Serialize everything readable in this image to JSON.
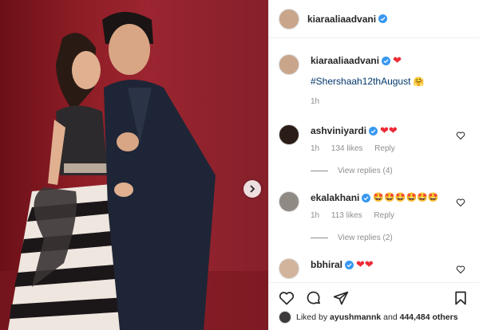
{
  "post": {
    "author": "kiaraaliaadvani",
    "verified": true
  },
  "caption": {
    "author": "kiaraaliaadvani",
    "emoji": "❤",
    "hashtag": "#Shershaah12thAugust",
    "hashtag_emoji": "🤗",
    "time": "1h"
  },
  "comments": [
    {
      "author": "ashviniyardi",
      "text": "❤❤",
      "time": "1h",
      "likes": "134 likes",
      "reply_label": "Reply",
      "view_replies": "View replies (4)"
    },
    {
      "author": "ekalakhani",
      "text": "🤩🤩🤩🤩🤩🤩",
      "time": "1h",
      "likes": "113 likes",
      "reply_label": "Reply",
      "view_replies": "View replies (2)"
    },
    {
      "author": "bbhiral",
      "text": "❤❤"
    }
  ],
  "likes_summary": {
    "prefix": "Liked by",
    "user": "ayushmannk",
    "joiner": "and",
    "count": "444,484 others"
  },
  "colors": {
    "verified": "#3897f0",
    "heart": "#ed2a36",
    "background": "#8e1d26"
  },
  "icons": {
    "like": "heart-outline-icon",
    "comment": "comment-bubble-icon",
    "share": "paper-plane-icon",
    "save": "bookmark-icon",
    "next": "chevron-right-icon"
  }
}
